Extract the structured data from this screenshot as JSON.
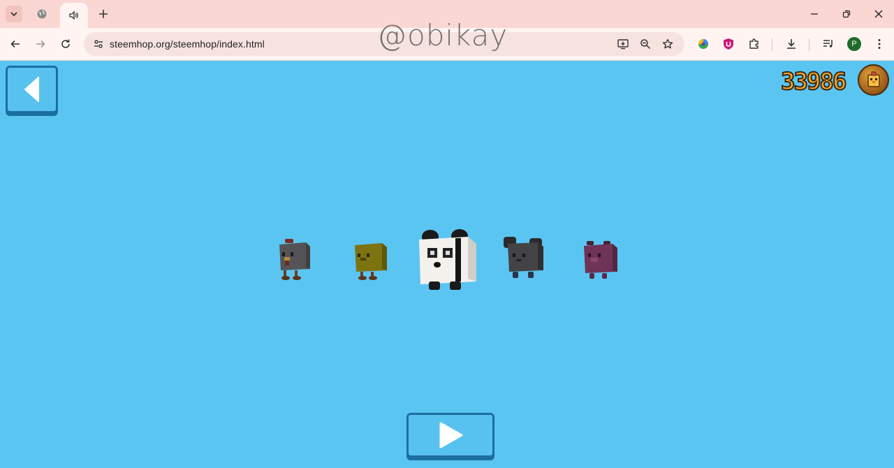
{
  "browser": {
    "url": "steemhop.org/steemhop/index.html",
    "avatar_initial": "P",
    "tabs": [
      {
        "icon": "globe-icon"
      },
      {
        "icon": "speaker-icon",
        "active": true
      }
    ],
    "extensions": [
      "chrome-web-store-icon",
      "ublock-icon",
      "puzzle-icon"
    ]
  },
  "watermark": "@obikay",
  "game": {
    "score": "33986",
    "characters": [
      "chicken",
      "chick",
      "panda",
      "mouse",
      "pig"
    ],
    "selected_character": "panda",
    "colors": {
      "background": "#5bc5f2",
      "button_border": "#1b6fa0",
      "score_fill": "#f3a829"
    }
  }
}
